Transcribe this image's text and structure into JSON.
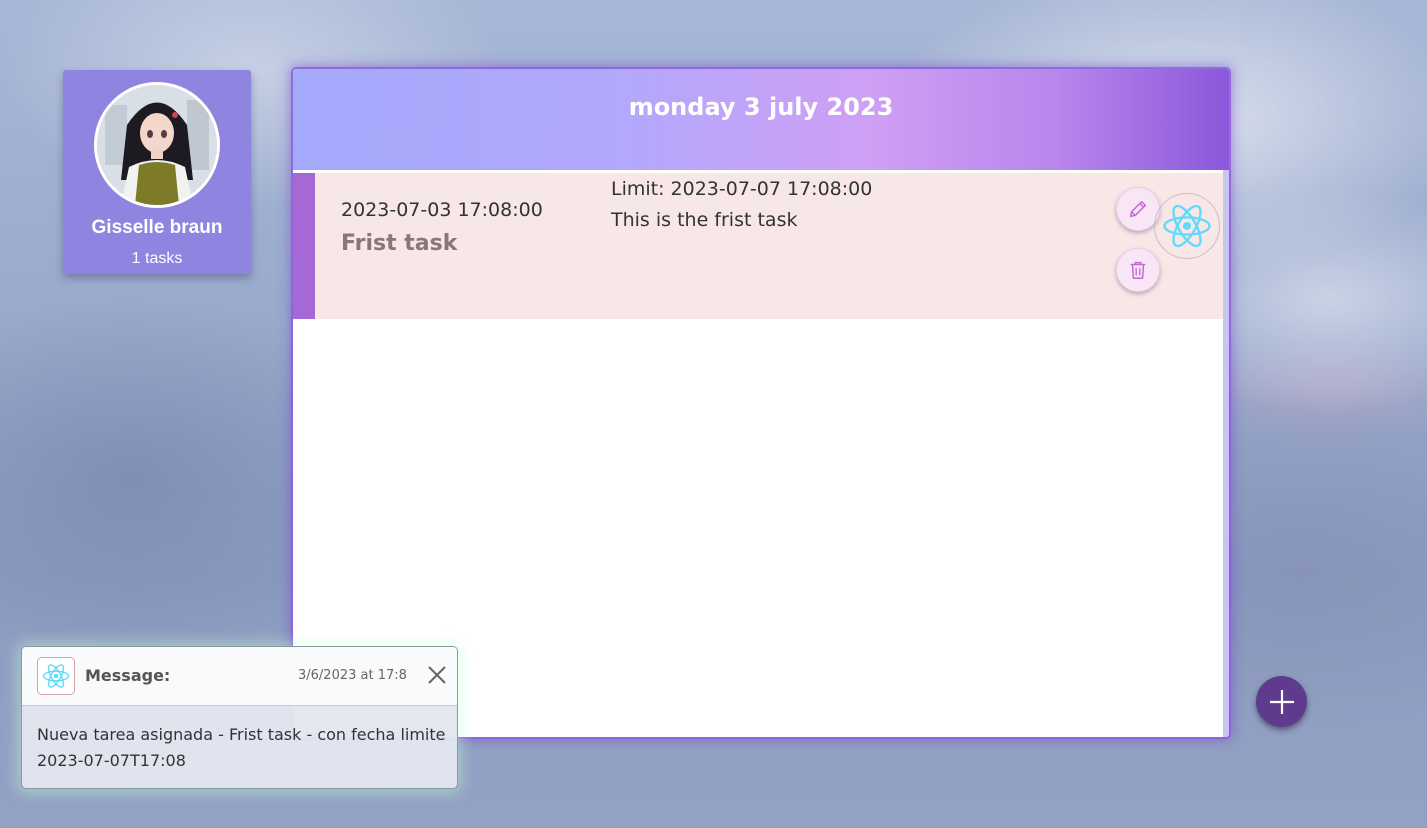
{
  "profile": {
    "name": "Gisselle braun",
    "task_count": "1 tasks"
  },
  "board": {
    "date_title": "monday 3 july 2023",
    "tasks": [
      {
        "created": "2023-07-03 17:08:00",
        "title": "Frist task",
        "limit": "Limit: 2023-07-07 17:08:00",
        "description": "This is the frist task"
      }
    ]
  },
  "toast": {
    "label": "Message:",
    "time": "3/6/2023 at 17:8",
    "body": "Nueva tarea asignada - Frist task - con fecha limite 2023-07-07T17:08"
  },
  "icons": {
    "edit": "pencil-icon",
    "delete": "trash-icon",
    "react": "react-logo-icon",
    "add": "plus-icon",
    "close": "close-icon"
  },
  "colors": {
    "card_purple": "#8f84e0",
    "task_accent": "#a668d4",
    "task_background": "#f7e7e6",
    "add_button": "#5f3b8e",
    "react_cyan": "#61dafb"
  }
}
